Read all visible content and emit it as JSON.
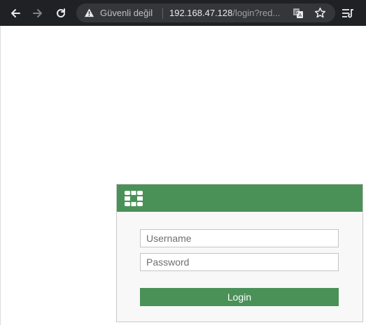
{
  "browser": {
    "security_label": "Güvenli değil",
    "url_host": "192.168.47.128",
    "url_path": "/login?red...",
    "icons": {
      "back": "back-arrow-icon",
      "forward": "forward-arrow-icon",
      "reload": "reload-icon",
      "warning": "warning-icon",
      "translate": "translate-icon",
      "bookmark": "star-icon",
      "reading_list": "reading-list-icon"
    }
  },
  "login": {
    "header_color": "#4a9158",
    "logo": "fortinet-logo-icon",
    "username_placeholder": "Username",
    "password_placeholder": "Password",
    "button_label": "Login"
  }
}
